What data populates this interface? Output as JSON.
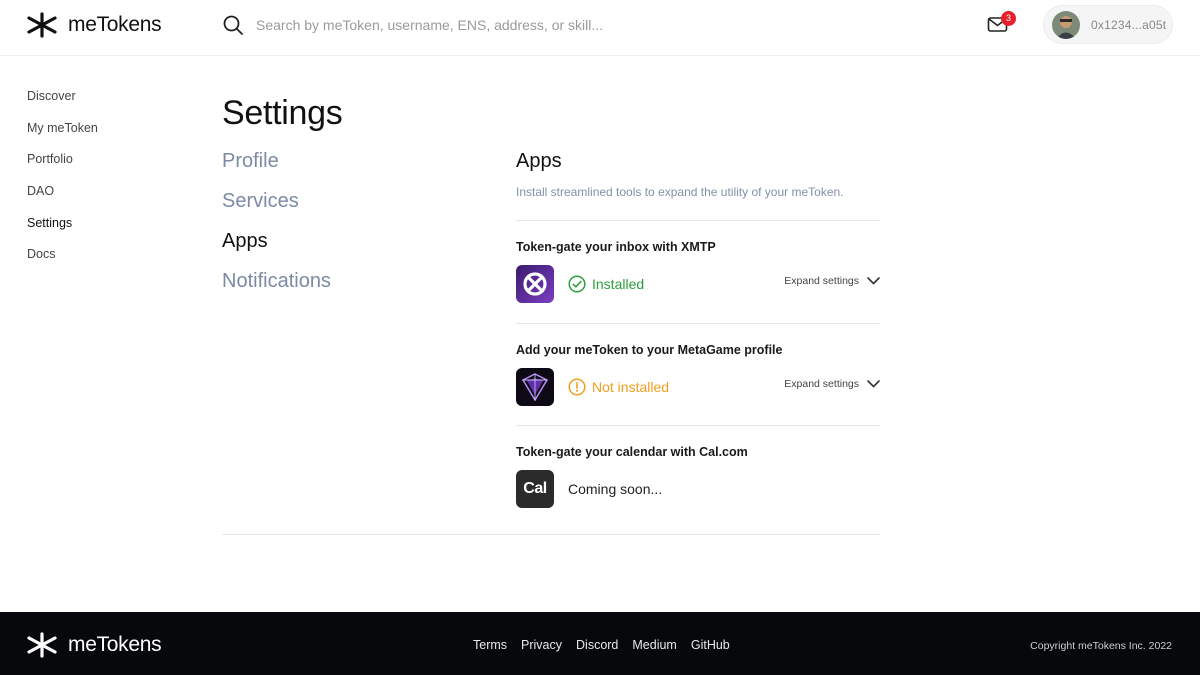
{
  "brand": {
    "name": "meTokens"
  },
  "search": {
    "placeholder": "Search by meToken, username, ENS, address, or skill..."
  },
  "header": {
    "mail_count": "3",
    "account_address": "0x1234...a05t"
  },
  "sidebar": {
    "items": [
      {
        "label": "Discover"
      },
      {
        "label": "My meToken"
      },
      {
        "label": "Portfolio"
      },
      {
        "label": "DAO"
      },
      {
        "label": "Settings",
        "active": true
      },
      {
        "label": "Docs"
      }
    ]
  },
  "settings": {
    "title": "Settings",
    "nav": [
      {
        "label": "Profile"
      },
      {
        "label": "Services"
      },
      {
        "label": "Apps",
        "active": true
      },
      {
        "label": "Notifications"
      }
    ]
  },
  "apps": {
    "title": "Apps",
    "description": "Install streamlined tools to expand the utility of your meToken.",
    "items": [
      {
        "title": "Token-gate your inbox with XMTP",
        "icon": "xmtp-logo",
        "status": "Installed",
        "status_type": "installed",
        "expand_label": "Expand settings"
      },
      {
        "title": "Add your meToken to your MetaGame profile",
        "icon": "metagame-logo",
        "status": "Not installed",
        "status_type": "not-installed",
        "expand_label": "Expand settings"
      },
      {
        "title": "Token-gate your calendar with Cal.com",
        "icon": "cal-logo",
        "icon_text": "Cal",
        "status": "Coming soon...",
        "status_type": "coming-soon"
      }
    ]
  },
  "footer": {
    "links": [
      "Terms",
      "Privacy",
      "Discord",
      "Medium",
      "GitHub"
    ],
    "copyright": "Copyright meTokens Inc. 2022"
  },
  "colors": {
    "installed": "#2f9e3a",
    "not_installed": "#f0a020",
    "muted_nav": "#7c8aa5",
    "footer_bg": "#06080b",
    "badge": "#e8202a"
  }
}
